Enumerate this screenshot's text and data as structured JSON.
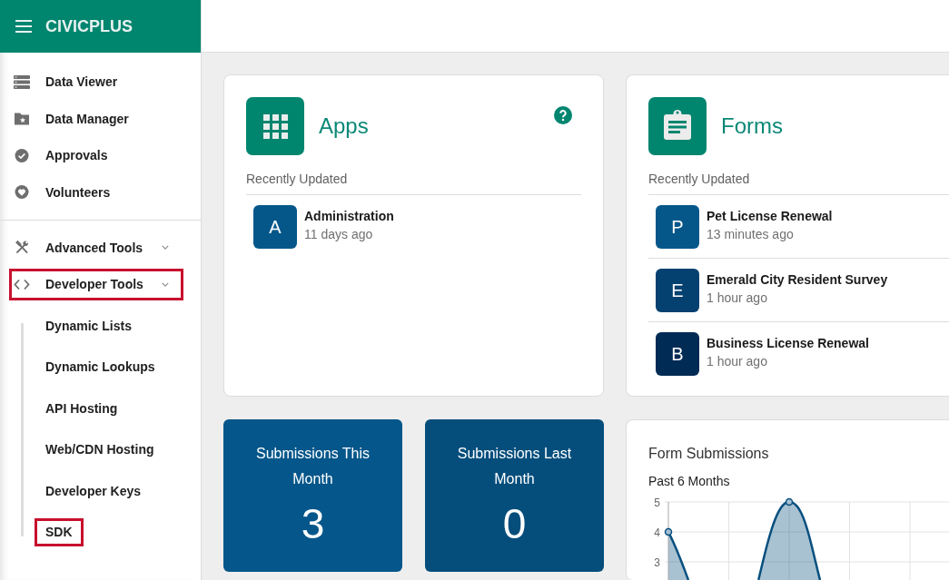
{
  "sidebar": {
    "title": "CIVICPLUS",
    "groups": [
      {
        "items": [
          {
            "kind": "link",
            "label": "Data Viewer",
            "highlighted": false
          },
          {
            "kind": "link",
            "label": "Data Manager",
            "highlighted": false
          },
          {
            "kind": "link",
            "label": "Approvals",
            "highlighted": false
          },
          {
            "kind": "link",
            "label": "Volunteers",
            "highlighted": false
          }
        ]
      },
      {
        "items": [
          {
            "kind": "menu",
            "label": "Advanced Tools",
            "highlighted": false
          },
          {
            "kind": "menu",
            "label": "Developer Tools",
            "highlighted": true,
            "children": [
              {
                "label": "Dynamic Lists",
                "highlighted": false
              },
              {
                "label": "Dynamic Lookups",
                "highlighted": false
              },
              {
                "label": "API Hosting",
                "highlighted": false
              },
              {
                "label": "Web/CDN Hosting",
                "highlighted": false
              },
              {
                "label": "Developer Keys",
                "highlighted": false
              },
              {
                "label": "SDK",
                "highlighted": true
              }
            ]
          }
        ]
      }
    ]
  },
  "cards": [
    {
      "title": "Apps",
      "help": true,
      "subtitle": "Recently Updated",
      "items": [
        {
          "initial": "A",
          "color": "#05578a",
          "name": "Administration",
          "updated": "11 days ago"
        }
      ]
    },
    {
      "title": "Forms",
      "help": false,
      "subtitle": "Recently Updated",
      "items": [
        {
          "initial": "P",
          "color": "#05578a",
          "name": "Pet License Renewal",
          "updated": "13 minutes ago"
        },
        {
          "initial": "E",
          "color": "#054170",
          "name": "Emerald City Resident Survey",
          "updated": "1 hour ago"
        },
        {
          "initial": "B",
          "color": "#002b55",
          "name": "Business License Renewal",
          "updated": "1 hour ago"
        }
      ]
    }
  ],
  "stats": [
    {
      "label": "Submissions This Month",
      "value": "3",
      "color": "#05568a"
    },
    {
      "label": "Submissions Last Month",
      "value": "0",
      "color": "#054e7c"
    }
  ],
  "chart_card": {
    "title": "Form Submissions",
    "subtitle": "Past 6 Months",
    "y_axis_labels": [
      "5",
      "4",
      "3"
    ]
  }
}
